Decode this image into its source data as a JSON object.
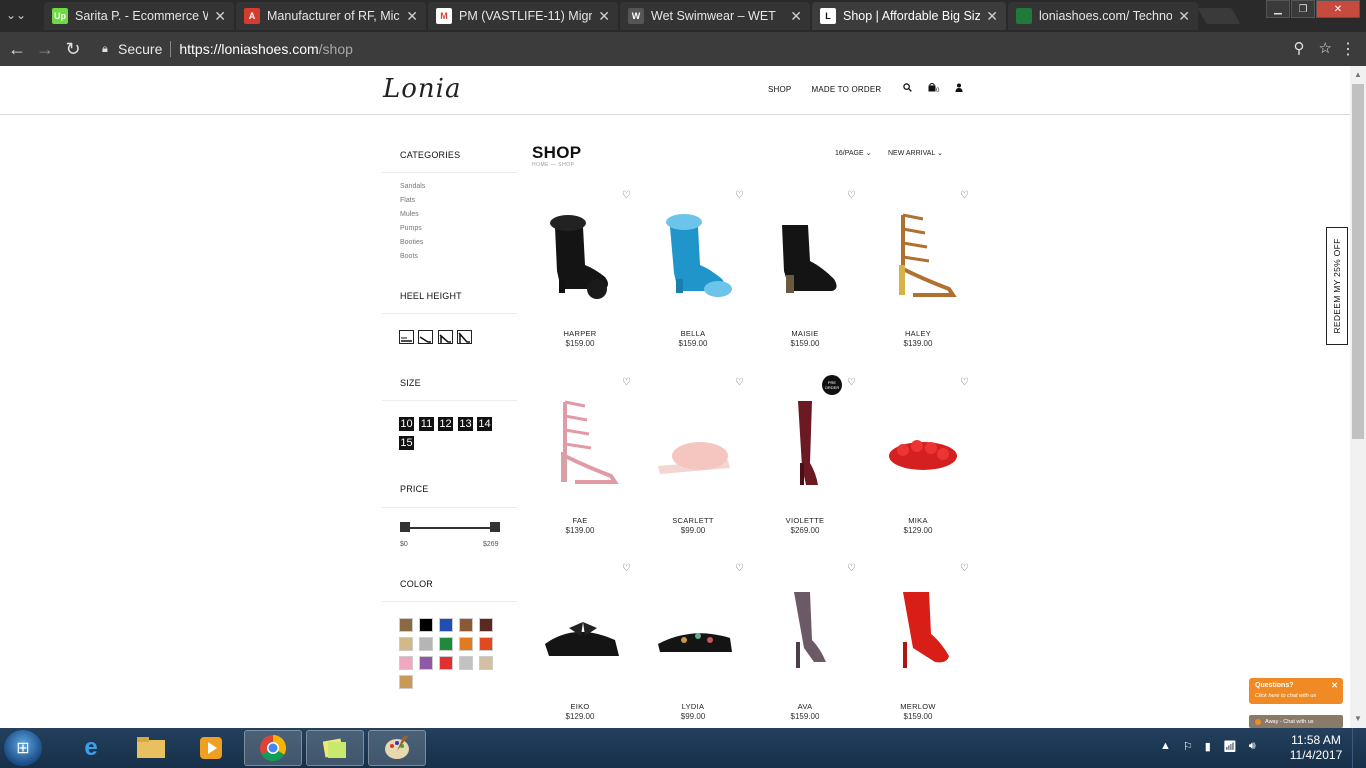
{
  "browser": {
    "tabs": [
      {
        "title": "Sarita P. - Ecommerce W",
        "icon": "upwork-icon",
        "fav_text": "Up",
        "color": "#6fda44"
      },
      {
        "title": "Manufacturer of RF, Micr",
        "icon": "pdf-icon",
        "fav_text": "A",
        "color": "#d33c2f"
      },
      {
        "title": "PM (VASTLIFE-11) Migrat",
        "icon": "gmail-icon",
        "fav_text": "M",
        "color": "#d44638"
      },
      {
        "title": "Wet Swimwear – WET",
        "icon": "wet-icon",
        "fav_text": "W",
        "color": "#555555"
      },
      {
        "title": "Shop | Affordable Big Siz",
        "icon": "lonia-icon",
        "fav_text": "L",
        "color": "#111111"
      },
      {
        "title": "loniashoes.com/ Technol",
        "icon": "sheets-icon",
        "fav_text": "",
        "color": "#1f7a3a"
      }
    ],
    "secure_label": "Secure",
    "url_host": "https://loniashoes.com",
    "url_path": "/shop"
  },
  "site": {
    "logo": "Lonia",
    "nav": [
      "SHOP",
      "MADE TO ORDER"
    ],
    "cart_count": "0"
  },
  "sidebar": {
    "categories_title": "CATEGORIES",
    "categories": [
      "Sandals",
      "Flats",
      "Mules",
      "Pumps",
      "Booties",
      "Boots"
    ],
    "heel_title": "HEEL HEIGHT",
    "size_title": "SIZE",
    "sizes": [
      "10",
      "11",
      "12",
      "13",
      "14",
      "15"
    ],
    "price_title": "PRICE",
    "price_min": "$0",
    "price_max": "$269",
    "color_title": "COLOR",
    "colors": [
      "#8a6a45",
      "#000000",
      "#1e4fb5",
      "#8b5a35",
      "#5a2a22",
      "#d2b98a",
      "#b5b5b5",
      "#1e8a3a",
      "#e07b20",
      "#e04a1e",
      "#f2a7c0",
      "#8e5aa5",
      "#e03030",
      "#c2c2c2",
      "#d4bfa5",
      "#c89a5a"
    ]
  },
  "shop": {
    "title": "SHOP",
    "breadcrumb": "HOME — SHOP",
    "per_page": "16/PAGE",
    "sort": "NEW ARRIVAL",
    "products": [
      {
        "name": "HARPER",
        "price": "$159.00"
      },
      {
        "name": "BELLA",
        "price": "$159.00"
      },
      {
        "name": "MAISIE",
        "price": "$159.00"
      },
      {
        "name": "HALEY",
        "price": "$139.00"
      },
      {
        "name": "FAE",
        "price": "$139.00"
      },
      {
        "name": "SCARLETT",
        "price": "$99.00"
      },
      {
        "name": "VIOLETTE",
        "price": "$269.00",
        "badge": "PRE ORDER"
      },
      {
        "name": "MIKA",
        "price": "$129.00"
      },
      {
        "name": "EIKO",
        "price": "$129.00"
      },
      {
        "name": "LYDIA",
        "price": "$99.00"
      },
      {
        "name": "AVA",
        "price": "$159.00"
      },
      {
        "name": "MERLOW",
        "price": "$159.00"
      }
    ]
  },
  "promo": {
    "redeem": "REDEEM MY 25% OFF"
  },
  "chat": {
    "question": "Questions?",
    "cta": "Click here to chat with us",
    "away": "Away - Chat with us"
  },
  "taskbar": {
    "time": "11:58 AM",
    "date": "11/4/2017"
  }
}
